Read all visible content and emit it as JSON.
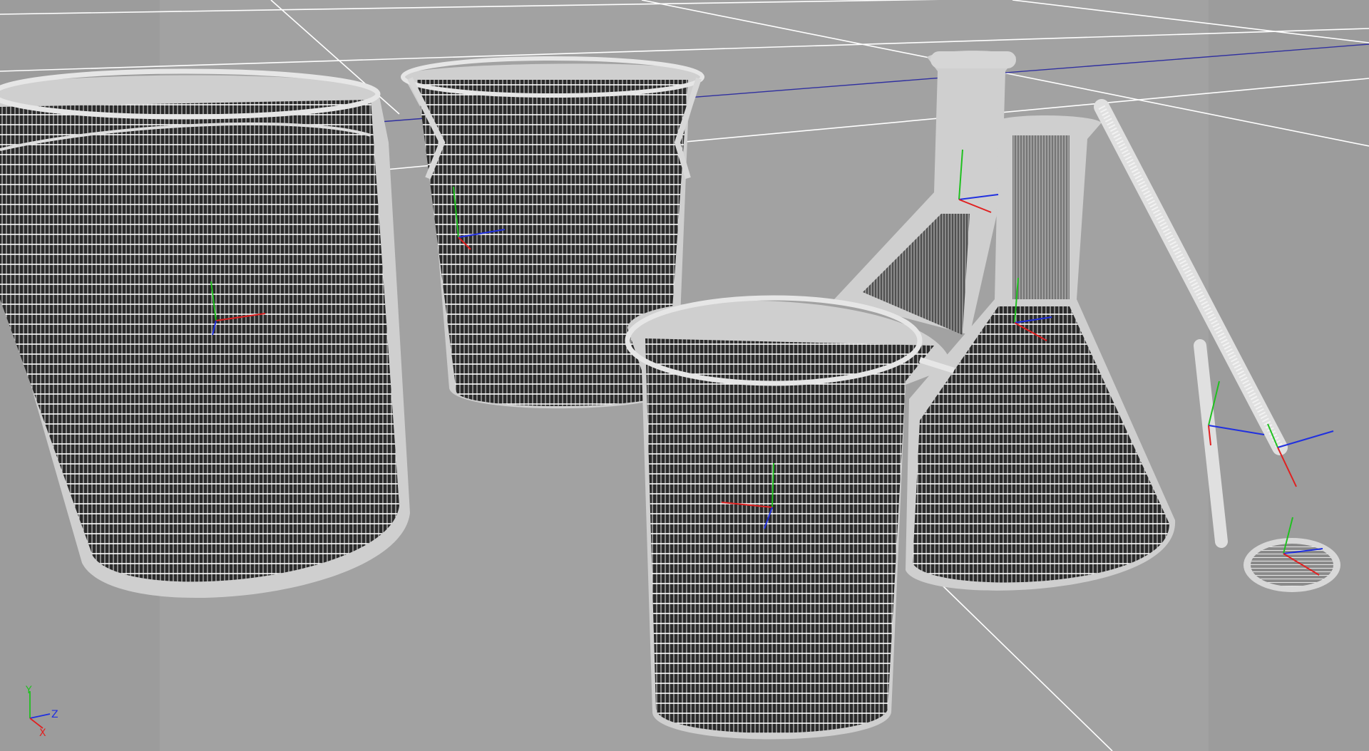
{
  "viewport": {
    "background": "#a2a2a2",
    "side_band_color": "#9a9a9a",
    "grid_color": "#ffffff",
    "horizon_axis_color": "#3030a0",
    "wire_color": "#ffffff",
    "solid_color": "#cfcfcf",
    "interior_color": "#2a2a2a"
  },
  "objects": [
    {
      "name": "large-beaker",
      "kind": "beaker"
    },
    {
      "name": "back-beaker",
      "kind": "beaker"
    },
    {
      "name": "front-beaker",
      "kind": "beaker"
    },
    {
      "name": "tall-flask",
      "kind": "erlenmeyer-flask"
    },
    {
      "name": "short-flask",
      "kind": "erlenmeyer-flask"
    },
    {
      "name": "long-glass-rod",
      "kind": "rod"
    },
    {
      "name": "short-glass-rod",
      "kind": "rod"
    },
    {
      "name": "watch-glass",
      "kind": "dish"
    }
  ],
  "axis_colors": {
    "x": "#e02020",
    "y": "#20c020",
    "z": "#2030e0"
  },
  "orientation_gizmo": {
    "labels": {
      "y": "Y",
      "z": "Z",
      "x": "X"
    }
  }
}
